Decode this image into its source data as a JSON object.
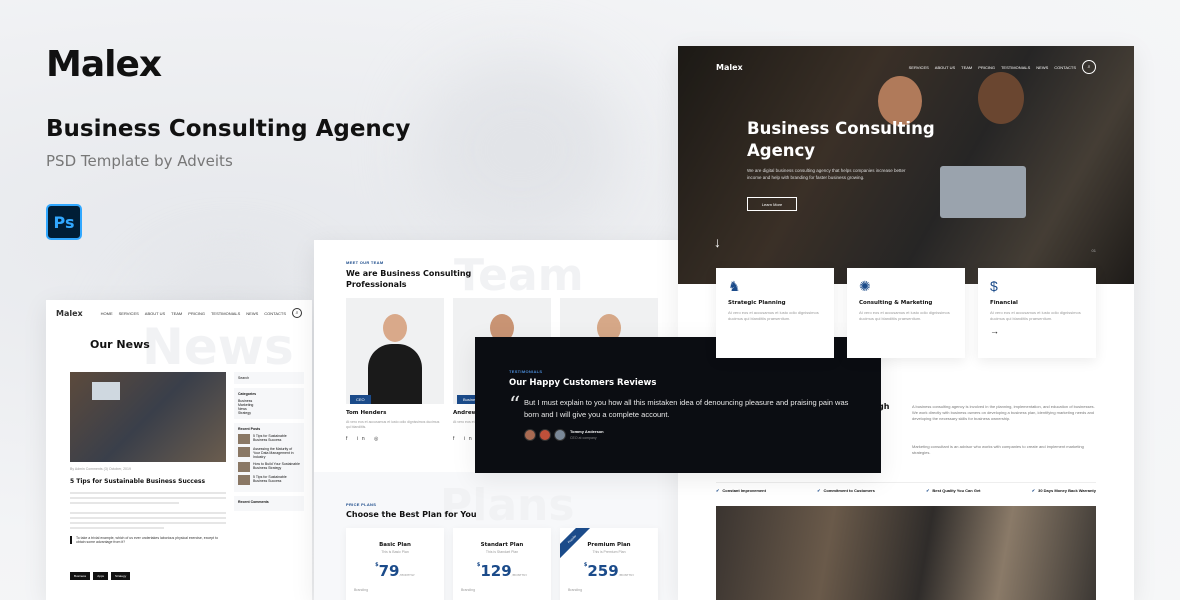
{
  "intro": {
    "logo": "Malex",
    "title": "Business Consulting Agency",
    "subtitle": "PSD Template by Adveits",
    "ps_label": "Ps",
    "ps_color": "#31a8ff"
  },
  "nav": {
    "logo": "Malex",
    "items": [
      "SERVICES",
      "ABOUT US",
      "TEAM",
      "PRICING",
      "TESTIMONIALS",
      "NEWS",
      "CONTACTS"
    ],
    "mini_items": [
      "HOME",
      "SERVICES",
      "ABOUT US",
      "TEAM",
      "PRICING",
      "TESTIMONIALS",
      "NEWS",
      "CONTACTS"
    ]
  },
  "news": {
    "watermark": "News",
    "title": "Our News",
    "meta": "By Admin    Comments (3)    October, 2019",
    "post_title": "5 Tips for Sustainable Business Success",
    "quote": "To take a trivial example, which of us ever undertakes laborious physical exercise, except to obtain some advantage from it?",
    "tags": [
      "Business",
      "Apps",
      "Strategy"
    ],
    "search_placeholder": "Search",
    "categories_title": "Categories",
    "categories": [
      "Business",
      "Marketing",
      "News",
      "Strategy"
    ],
    "recent_title": "Recent Posts",
    "recent_posts": [
      "5 Tips for Sustainable Business Success",
      "Assessing the Maturity of Your Data Management in Industry",
      "How to Build Your Sustainable Business Strategy",
      "5 Tips for Sustainable Business Success"
    ],
    "comments_title": "Recent Comments"
  },
  "team": {
    "watermark": "Team",
    "eyebrow": "MEET OUR TEAM",
    "title": "We are Business Consulting Professionals",
    "members": [
      {
        "name": "Tom Henders",
        "role": "CEO",
        "text": "At vero eos et accusamus et iusto odio dignissimos ducimus qui blanditiis."
      },
      {
        "name": "Andrew",
        "role": "Business",
        "text": "At vero eos et accusamus et iusto odio dignissimos ducimus."
      },
      {
        "name": "",
        "role": "",
        "text": ""
      }
    ],
    "socials": "f in ◎"
  },
  "pricing": {
    "watermark": "Plans",
    "eyebrow": "PRICE PLANS",
    "title": "Choose the Best Plan for You",
    "plans": [
      {
        "name": "Basic Plan",
        "sub": "This is Basic Plan",
        "price": "79",
        "period": "/MONTHLY",
        "feature": "Branding"
      },
      {
        "name": "Standart Plan",
        "sub": "This is Standart Plan",
        "price": "129",
        "period": "/MONTHLY",
        "feature": "Branding"
      },
      {
        "name": "Premium Plan",
        "sub": "This is Premium Plan",
        "price": "259",
        "period": "/MONTHLY",
        "feature": "Branding",
        "ribbon": "Popular"
      }
    ]
  },
  "reviews": {
    "eyebrow": "TESTIMONIALS",
    "title": "Our Happy Customers Reviews",
    "quote": "But I must explain to you how all this mistaken idea of denouncing pleasure and praising pain was born and I will give you a complete account.",
    "name": "Tommy Anderson",
    "role": "CEO at company"
  },
  "hero": {
    "title": "Business Consulting Agency",
    "text": "We are digital business consulting agency that helps companies increase better income and help with branding for faster business growing.",
    "button": "Learn More",
    "arrow": "↓",
    "page": "01",
    "services": [
      {
        "title": "Strategic Planning",
        "text": "At vero eos et accusamus et iusto odio dignissimos ducimus qui blanditiis praesentium.",
        "icon": "♞"
      },
      {
        "title": "Consulting & Marketing",
        "text": "At vero eos et accusamus et iusto odio dignissimos ducimus qui blanditiis praesentium.",
        "icon": "✺"
      },
      {
        "title": "Financial",
        "text": "At vero eos et accusamus et iusto odio dignissimos ducimus qui blanditiis praesentium.",
        "icon": "$",
        "arrow": "→"
      }
    ],
    "about_title_fragment": "gh",
    "about_text": "A business consulting agency is involved in the planning, implementation, and education of businesses. We work directly with business owners on developing a business plan, identifying marketing needs and developing the necessary skills for business ownership.",
    "about_text2": "Marketing consultant is an advisor who works with companies to create and implement marketing strategies.",
    "features": [
      "Constant Improvement",
      "Commitment to Customers",
      "Best Quality You Can Get",
      "30 Days Money Back Warranty"
    ]
  }
}
